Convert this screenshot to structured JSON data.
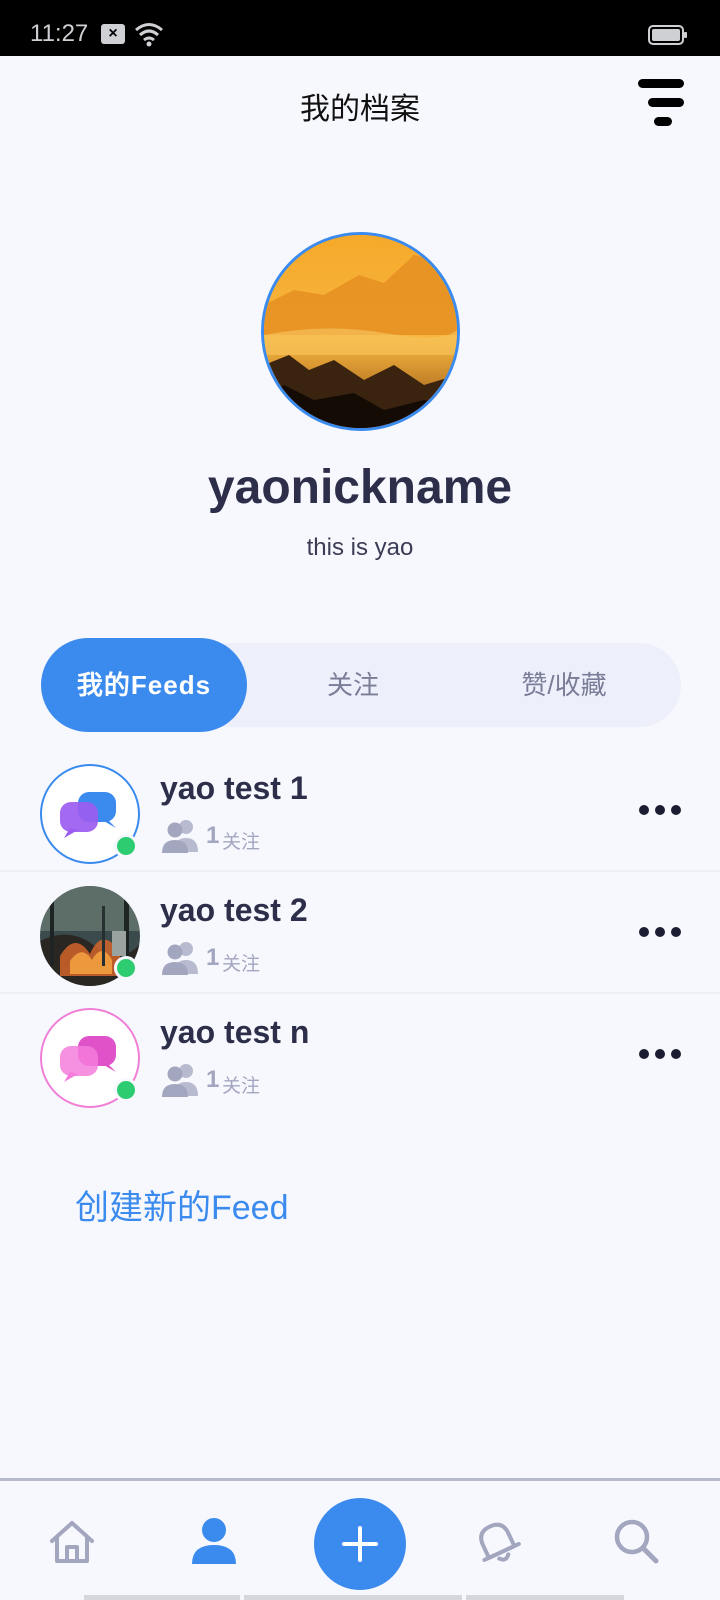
{
  "status_bar": {
    "time": "11:27"
  },
  "header": {
    "title": "我的档案"
  },
  "profile": {
    "nickname": "yaonickname",
    "bio": "this is yao"
  },
  "tabs": [
    {
      "label": "我的Feeds",
      "active": true
    },
    {
      "label": "关注",
      "active": false
    },
    {
      "label": "赞/收藏",
      "active": false
    }
  ],
  "feeds": [
    {
      "name": "yao test 1",
      "count": "1",
      "follow_label": "关注",
      "avatar": "chat-bubbles-blue-purple",
      "online": true
    },
    {
      "name": "yao test 2",
      "count": "1",
      "follow_label": "关注",
      "avatar": "photo-forest-fire",
      "online": true
    },
    {
      "name": "yao test n",
      "count": "1",
      "follow_label": "关注",
      "avatar": "chat-bubbles-pink",
      "online": true
    }
  ],
  "create_feed_label": "创建新的Feed",
  "bottom_nav": [
    {
      "icon": "home-icon",
      "active": false
    },
    {
      "icon": "profile-icon",
      "active": true
    },
    {
      "icon": "plus-icon",
      "active": false
    },
    {
      "icon": "bell-icon",
      "active": false
    },
    {
      "icon": "search-icon",
      "active": false
    }
  ],
  "colors": {
    "accent": "#3b8bef",
    "online": "#2ecc71",
    "text_dark": "#2d2f4a",
    "text_muted": "#a3a6bf",
    "background": "#f7f8fd"
  }
}
